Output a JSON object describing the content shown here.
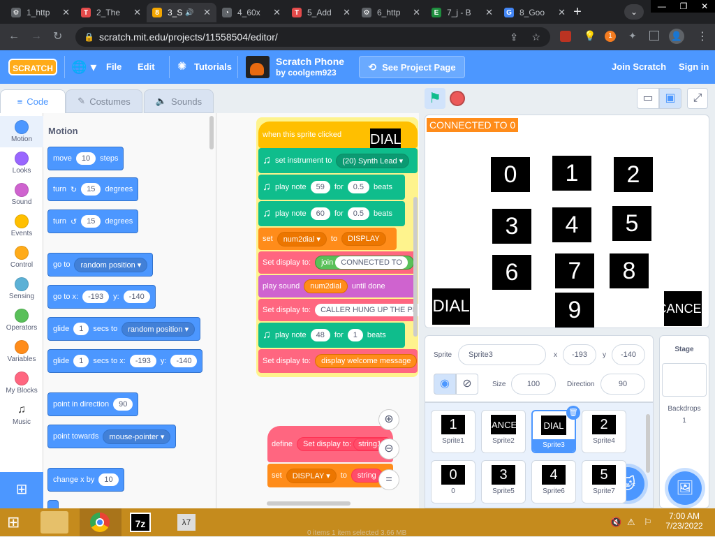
{
  "browser": {
    "tabs": [
      {
        "label": "1_http",
        "color": "#5f6368",
        "glyph": "⚙"
      },
      {
        "label": "2_The",
        "color": "#e34a4a",
        "glyph": "T"
      },
      {
        "label": "3_S",
        "color": "#f4a600",
        "glyph": "8",
        "active": true
      },
      {
        "label": "4_60x",
        "color": "#5f6368",
        "glyph": "◔"
      },
      {
        "label": "5_Add",
        "color": "#e34a4a",
        "glyph": "T"
      },
      {
        "label": "6_http",
        "color": "#5f6368",
        "glyph": "⚙"
      },
      {
        "label": "7_j - B",
        "color": "#1e8e3e",
        "glyph": "E"
      },
      {
        "label": "8_Goo",
        "color": "#4285f4",
        "glyph": "G"
      }
    ],
    "new_tab": "+",
    "url": "scratch.mit.edu/projects/11558504/editor/",
    "extension_badge": "1"
  },
  "menubar": {
    "logo": "SCRATCH",
    "file": "File",
    "edit": "Edit",
    "tutorials": "Tutorials",
    "project_title": "Scratch Phone",
    "author": "by coolgem923",
    "see_project": "See Project Page",
    "join": "Join Scratch",
    "signin": "Sign in"
  },
  "editor_tabs": {
    "code": "Code",
    "costumes": "Costumes",
    "sounds": "Sounds"
  },
  "categories": [
    {
      "label": "Motion",
      "color": "#4c97ff"
    },
    {
      "label": "Looks",
      "color": "#9966ff"
    },
    {
      "label": "Sound",
      "color": "#cf63cf"
    },
    {
      "label": "Events",
      "color": "#ffbf00"
    },
    {
      "label": "Control",
      "color": "#ffab19"
    },
    {
      "label": "Sensing",
      "color": "#5cb1d6"
    },
    {
      "label": "Operators",
      "color": "#59c059"
    },
    {
      "label": "Variables",
      "color": "#ff8c1a"
    },
    {
      "label": "My Blocks",
      "color": "#ff6680"
    },
    {
      "label": "Music",
      "color": "#0fbd8c"
    }
  ],
  "palette": {
    "heading": "Motion",
    "move": {
      "a": "move",
      "v": "10",
      "b": "steps"
    },
    "turn_right": {
      "a": "turn",
      "v": "15",
      "b": "degrees"
    },
    "turn_left": {
      "a": "turn",
      "v": "15",
      "b": "degrees"
    },
    "goto": {
      "a": "go to",
      "d": "random position"
    },
    "gotoxy": {
      "a": "go to x:",
      "x": "-193",
      "y_label": "y:",
      "y": "-140"
    },
    "glide": {
      "a": "glide",
      "v": "1",
      "b": "secs to",
      "d": "random position"
    },
    "glidexy": {
      "a": "glide",
      "v": "1",
      "b": "secs to x:",
      "x": "-193",
      "y_label": "y:",
      "y": "-140"
    },
    "point_dir": {
      "a": "point in direction",
      "v": "90"
    },
    "point_towards": {
      "a": "point towards",
      "d": "mouse-pointer"
    },
    "change_x": {
      "a": "change x by",
      "v": "10"
    }
  },
  "script": {
    "hat": "when this sprite clicked",
    "dial_badge": "DIAL",
    "b1": {
      "a": "set instrument to",
      "d": "(20) Synth Lead"
    },
    "b2": {
      "a": "play note",
      "v": "59",
      "b": "for",
      "w": "0.5",
      "c": "beats"
    },
    "b3": {
      "a": "play note",
      "v": "60",
      "b": "for",
      "w": "0.5",
      "c": "beats"
    },
    "b4": {
      "a": "set",
      "d": "num2dial",
      "b": "to",
      "w": "DISPLAY"
    },
    "b5": {
      "a": "Set display to:",
      "j": "join",
      "v": "CONNECTED TO"
    },
    "b6": {
      "a": "play sound",
      "v": "num2dial",
      "b": "until done"
    },
    "b7": {
      "a": "Set display to:",
      "v": "CALLER HUNG UP THE PH"
    },
    "b8": {
      "a": "play note",
      "v": "48",
      "b": "for",
      "w": "1",
      "c": "beats"
    },
    "b9": {
      "a": "Set display to:",
      "v": "display welcome message"
    },
    "define": {
      "a": "define",
      "b": "Set display to:",
      "v": "string1"
    },
    "setv": {
      "a": "set",
      "d": "DISPLAY",
      "b": "to",
      "v": "string"
    }
  },
  "stage": {
    "monitor": "CONNECTED TO 0",
    "digits": [
      "0",
      "1",
      "2",
      "3",
      "4",
      "5",
      "6",
      "7",
      "8",
      "9"
    ],
    "dial": "DIAL",
    "cancel": "CANCEL"
  },
  "sprite_info": {
    "sprite_label": "Sprite",
    "sprite_name": "Sprite3",
    "x_label": "x",
    "x": "-193",
    "y_label": "y",
    "y": "-140",
    "size_label": "Size",
    "size": "100",
    "dir_label": "Direction",
    "dir": "90"
  },
  "sprites": [
    {
      "thumb": "1",
      "name": "Sprite1"
    },
    {
      "thumb": "CANCEL",
      "name": "Sprite2"
    },
    {
      "thumb": "DIAL",
      "name": "Sprite3",
      "selected": true
    },
    {
      "thumb": "2",
      "name": "Sprite4"
    },
    {
      "thumb": "0",
      "name": "0"
    },
    {
      "thumb": "3",
      "name": "Sprite5"
    },
    {
      "thumb": "4",
      "name": "Sprite6"
    },
    {
      "thumb": "5",
      "name": "Sprite7"
    }
  ],
  "stage_panel": {
    "title": "Stage",
    "backdrops": "Backdrops",
    "count": "1"
  },
  "taskbar": {
    "time": "7:00 AM",
    "date": "7/23/2022",
    "status": "0 items    1 item selected  3.66 MB"
  }
}
